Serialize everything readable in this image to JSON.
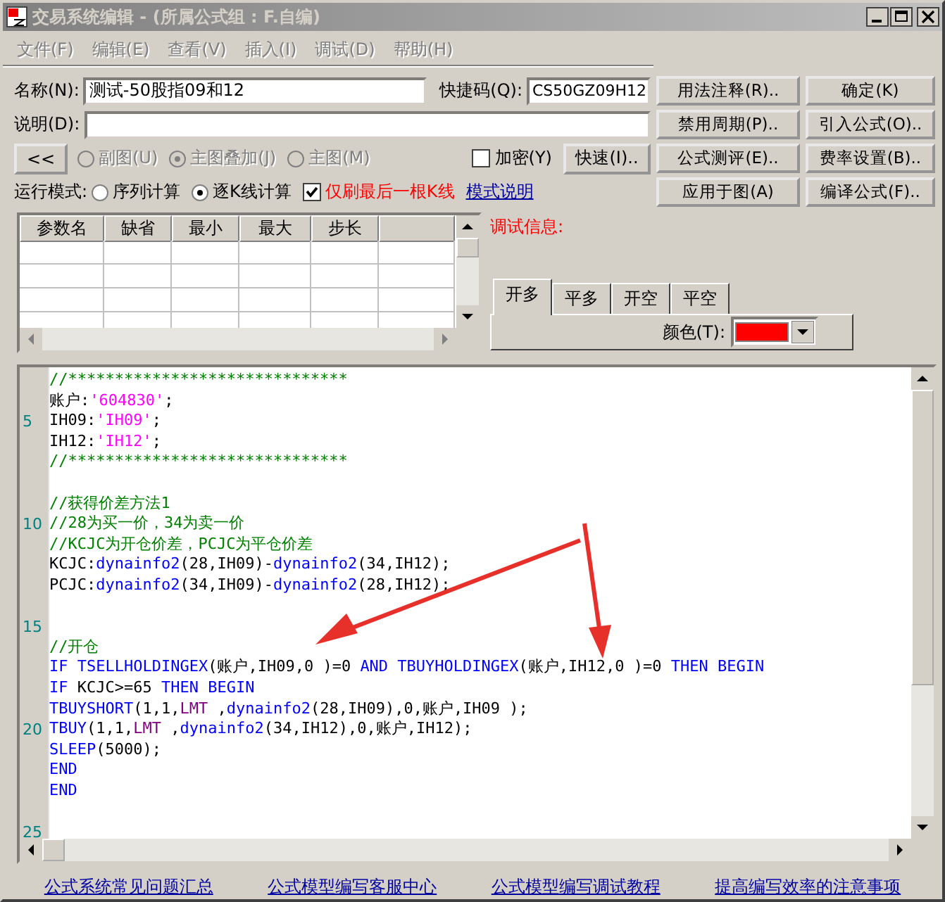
{
  "window": {
    "title": "交易系统编辑 - (所属公式组 : F.自编)"
  },
  "menu": [
    {
      "label": "文件(F)",
      "disabled": true
    },
    {
      "label": "编辑(E)",
      "disabled": true
    },
    {
      "label": "查看(V)",
      "disabled": true
    },
    {
      "label": "插入(I)",
      "disabled": true
    },
    {
      "label": "调试(D)",
      "disabled": true
    },
    {
      "label": "帮助(H)",
      "disabled": true
    }
  ],
  "name_field": {
    "label": "名称(N):",
    "value": "测试-50股指09和12"
  },
  "shortcut_field": {
    "label": "快捷码(Q):",
    "value": "CS50GZ09H12"
  },
  "description_field": {
    "label": "说明(D):"
  },
  "collapse_button": "<<",
  "chart_types": [
    {
      "label": "副图(U)",
      "selected": false,
      "disabled": true
    },
    {
      "label": "主图叠加(J)",
      "selected": true,
      "disabled": true
    },
    {
      "label": "主图(M)",
      "selected": false,
      "disabled": true
    }
  ],
  "encrypt": {
    "label": "加密(Y)",
    "checked": false
  },
  "quick_button": "快速(I)..",
  "run_mode": {
    "label": "运行模式:",
    "options": [
      {
        "label": "序列计算",
        "selected": false
      },
      {
        "label": "逐K线计算",
        "selected": true
      }
    ]
  },
  "last_bar_only": {
    "label": "仅刷最后一根K线",
    "checked": true
  },
  "mode_help_link": "模式说明",
  "buttons": [
    "用法注释(R)..",
    "确定(K)",
    "禁用周期(P)..",
    "引入公式(O)..",
    "公式测评(E)..",
    "费率设置(B)..",
    "应用于图(A)",
    "编译公式(F).."
  ],
  "params_table": {
    "columns": [
      "参数名",
      "缺省",
      "最小",
      "最大",
      "步长"
    ]
  },
  "debug_label": "调试信息:",
  "signal_tabs": [
    {
      "label": "开多",
      "selected": true
    },
    {
      "label": "平多",
      "selected": false
    },
    {
      "label": "开空",
      "selected": false
    },
    {
      "label": "平空",
      "selected": false
    }
  ],
  "color_picker": {
    "label": "颜色(T):",
    "color": "#ff0000"
  },
  "editor": {
    "lines": [
      {
        "tokens": [
          {
            "kind": "comment",
            "text": "//******************************"
          }
        ]
      },
      {
        "tokens": [
          {
            "kind": "plain",
            "text": "账户:"
          },
          {
            "kind": "string",
            "text": "'604830'"
          },
          {
            "kind": "plain",
            "text": ";"
          }
        ]
      },
      {
        "number": "5",
        "tokens": [
          {
            "kind": "plain",
            "text": "IH09:"
          },
          {
            "kind": "string",
            "text": "'IH09'"
          },
          {
            "kind": "plain",
            "text": ";"
          }
        ]
      },
      {
        "tokens": [
          {
            "kind": "plain",
            "text": "IH12:"
          },
          {
            "kind": "string",
            "text": "'IH12'"
          },
          {
            "kind": "plain",
            "text": ";"
          }
        ]
      },
      {
        "tokens": [
          {
            "kind": "comment",
            "text": "//******************************"
          }
        ]
      },
      {
        "kind": "blank"
      },
      {
        "tokens": [
          {
            "kind": "comment",
            "text": "//获得价差方法1"
          }
        ]
      },
      {
        "number": "10",
        "tokens": [
          {
            "kind": "comment",
            "text": "//28为买一价，34为卖一价"
          }
        ]
      },
      {
        "tokens": [
          {
            "kind": "comment",
            "text": "//KCJC为开仓价差，PCJC为平仓价差"
          }
        ]
      },
      {
        "tokens": [
          {
            "kind": "plain",
            "text": "KCJC:"
          },
          {
            "kind": "function",
            "text": "dynainfo2"
          },
          {
            "kind": "plain",
            "text": "(28,IH09)-"
          },
          {
            "kind": "function",
            "text": "dynainfo2"
          },
          {
            "kind": "plain",
            "text": "(34,IH12);"
          }
        ]
      },
      {
        "tokens": [
          {
            "kind": "plain",
            "text": "PCJC:"
          },
          {
            "kind": "function",
            "text": "dynainfo2"
          },
          {
            "kind": "plain",
            "text": "(34,IH09)-"
          },
          {
            "kind": "function",
            "text": "dynainfo2"
          },
          {
            "kind": "plain",
            "text": "(28,IH12);"
          }
        ]
      },
      {
        "kind": "blank"
      },
      {
        "number": "15"
      },
      {
        "tokens": [
          {
            "kind": "comment",
            "text": "//开仓"
          }
        ]
      },
      {
        "tokens": [
          {
            "kind": "keyword",
            "text": "IF TSELLHOLDINGEX"
          },
          {
            "kind": "plain",
            "text": "(账户,IH09,0 )=0 "
          },
          {
            "kind": "keyword",
            "text": "AND TBUYHOLDINGEX"
          },
          {
            "kind": "plain",
            "text": "(账户,IH12,0 )=0 "
          },
          {
            "kind": "keyword",
            "text": "THEN BEGIN"
          }
        ]
      },
      {
        "tokens": [
          {
            "kind": "keyword",
            "text": "IF"
          },
          {
            "kind": "plain",
            "text": " KCJC>=65 "
          },
          {
            "kind": "keyword",
            "text": "THEN BEGIN"
          }
        ]
      },
      {
        "tokens": [
          {
            "kind": "keyword",
            "text": "TBUYSHORT"
          },
          {
            "kind": "plain",
            "text": "(1,1,"
          },
          {
            "kind": "constant",
            "text": "LMT"
          },
          {
            "kind": "plain",
            "text": " ,"
          },
          {
            "kind": "function",
            "text": "dynainfo2"
          },
          {
            "kind": "plain",
            "text": "(28,IH09),0,账户,IH09 );"
          }
        ]
      },
      {
        "number": "20",
        "tokens": [
          {
            "kind": "keyword",
            "text": "TBUY"
          },
          {
            "kind": "plain",
            "text": "(1,1,"
          },
          {
            "kind": "constant",
            "text": "LMT"
          },
          {
            "kind": "plain",
            "text": " ,"
          },
          {
            "kind": "function",
            "text": "dynainfo2"
          },
          {
            "kind": "plain",
            "text": "(34,IH12),0,账户,IH12);"
          }
        ]
      },
      {
        "tokens": [
          {
            "kind": "keyword",
            "text": "SLEEP"
          },
          {
            "kind": "plain",
            "text": "(5000);"
          }
        ]
      },
      {
        "tokens": [
          {
            "kind": "keyword",
            "text": "END"
          }
        ]
      },
      {
        "tokens": [
          {
            "kind": "keyword",
            "text": "END"
          }
        ]
      },
      {
        "kind": "blank"
      },
      {
        "number": "25"
      }
    ]
  },
  "footer_links": [
    "公式系统常见问题汇总",
    "公式模型编写客服中心",
    "公式模型编写调试教程",
    "提高编写效率的注意事项"
  ]
}
